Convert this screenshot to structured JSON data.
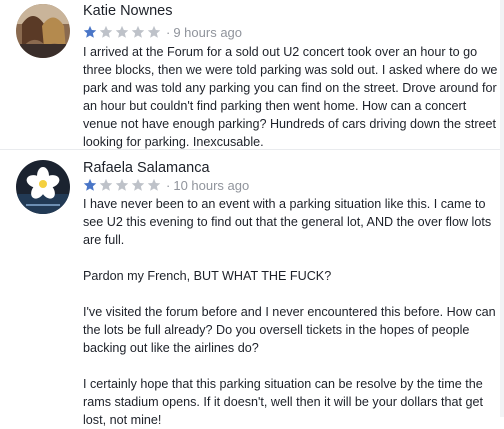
{
  "reviews": [
    {
      "author": "Katie Nownes",
      "rating": 1,
      "max_rating": 5,
      "time": "9 hours ago",
      "paragraphs": [
        "I arrived at the Forum for a sold out U2 concert took over an hour to go three blocks, then we were told parking was sold out. I asked where do we park and was told any parking you can find on the street. Drove around for an hour but couldn't find parking then went home. How can a concert venue not have enough parking? Hundreds of cars driving down the street looking for parking. Inexcusable."
      ]
    },
    {
      "author": "Rafaela Salamanca",
      "rating": 1,
      "max_rating": 5,
      "time": "10 hours ago",
      "paragraphs": [
        "I have never been to an event with a parking situation like this. I came to see U2 this evening to find out that the general lot, AND the over flow lots are full.",
        "Pardon my French, BUT WHAT THE FUCK?",
        "I've visited the forum before and I never encountered this before. How can the lots be full already? Do you oversell tickets in the hopes of people backing out like the airlines do?",
        "I certainly hope that this parking situation can be resolve by the time the rams stadium opens. If it doesn't, well then it will be your dollars that get lost, not mine!"
      ]
    }
  ],
  "colors": {
    "star_filled": "#4a76c7",
    "star_empty": "#bec2c9",
    "meta_text": "#90949c",
    "body_text": "#1d2129"
  },
  "icons": {
    "star": "star-icon",
    "avatar_1": "avatar-photo",
    "avatar_2": "avatar-flower"
  }
}
